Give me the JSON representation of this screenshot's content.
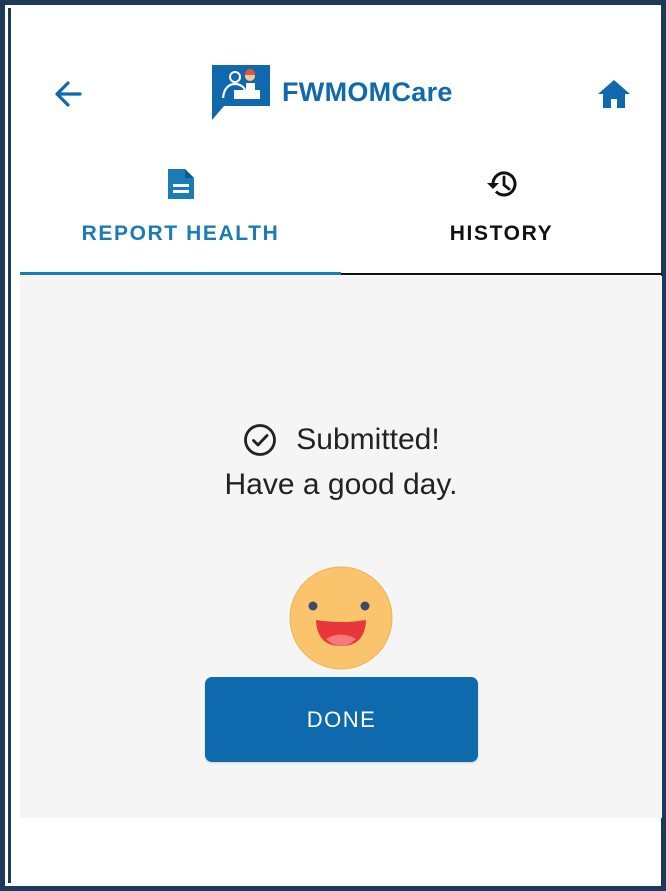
{
  "header": {
    "back_icon": "arrow-left-icon",
    "app_title": "FWMOMCare",
    "logo_icon": "chat-doctor-logo-icon",
    "home_icon": "home-icon"
  },
  "tabs": [
    {
      "label": "REPORT HEALTH",
      "icon": "document-icon",
      "active": true
    },
    {
      "label": "HISTORY",
      "icon": "history-icon",
      "active": false
    }
  ],
  "confirmation": {
    "icon": "check-circle-icon",
    "title": "Submitted!",
    "subtitle": "Have a good day.",
    "emoji": "smiling-face-icon"
  },
  "actions": {
    "done_label": "DONE"
  },
  "colors": {
    "accent": "#1169ad",
    "tab_active": "#1a7cb4",
    "button_bg": "#0e6aad",
    "content_bg": "#f5f5f6",
    "frame": "#1d3a5a",
    "smiley_face": "#f9c46c",
    "smiley_mouth": "#e8363b"
  }
}
